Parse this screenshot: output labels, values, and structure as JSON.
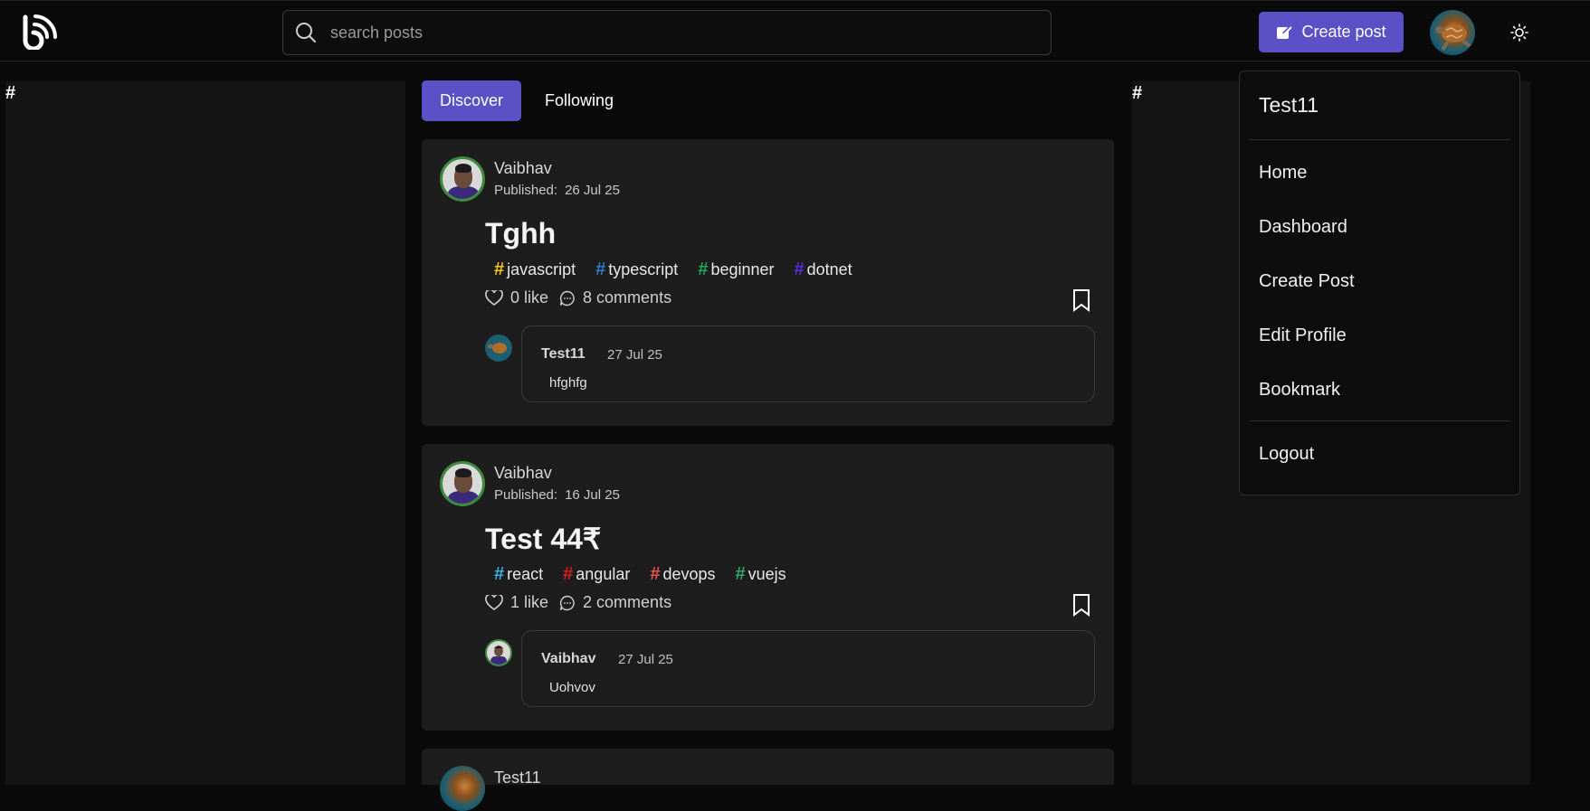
{
  "header": {
    "search_placeholder": "search posts",
    "create_post_label": "Create post"
  },
  "left_panel": {
    "hash": "#"
  },
  "right_panel": {
    "hash": "#"
  },
  "tabs": [
    {
      "label": "Discover",
      "active": true
    },
    {
      "label": "Following",
      "active": false
    }
  ],
  "posts": [
    {
      "author": "Vaibhav",
      "published_label": "Published:",
      "date": "26 Jul 25",
      "title": "Tghh",
      "tags": [
        {
          "name": "javascript",
          "color": "#f5c518"
        },
        {
          "name": "typescript",
          "color": "#3178c6"
        },
        {
          "name": "beginner",
          "color": "#22a35a"
        },
        {
          "name": "dotnet",
          "color": "#5b2bd6"
        }
      ],
      "likes": "0 like",
      "comments": "8 comments",
      "comment": {
        "author": "Test11",
        "date": "27 Jul 25",
        "text": "hfghfg"
      }
    },
    {
      "author": "Vaibhav",
      "published_label": "Published:",
      "date": "16 Jul 25",
      "title": "Test 44₹",
      "tags": [
        {
          "name": "react",
          "color": "#3aaee0"
        },
        {
          "name": "angular",
          "color": "#dd1b16"
        },
        {
          "name": "devops",
          "color": "#e8534a"
        },
        {
          "name": "vuejs",
          "color": "#2fa866"
        }
      ],
      "likes": "1 like",
      "comments": "2 comments",
      "comment": {
        "author": "Vaibhav",
        "date": "27 Jul 25",
        "text": "Uohvov"
      }
    },
    {
      "author": "Test11"
    }
  ],
  "menu": {
    "title": "Test11",
    "items": [
      "Home",
      "Dashboard",
      "Create Post",
      "Edit Profile",
      "Bookmark"
    ],
    "logout": "Logout"
  },
  "colors": {
    "accent": "#5b50c6",
    "card": "#1e1d1e",
    "panel": "#141414"
  }
}
